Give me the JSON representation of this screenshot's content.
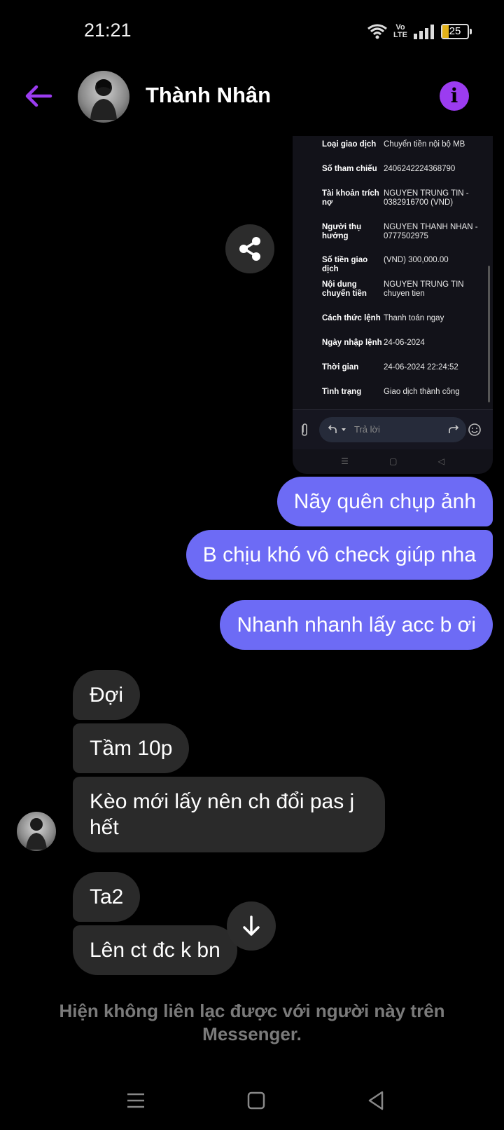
{
  "status_bar": {
    "time": "21:21",
    "network": "VoLTE",
    "battery": "25"
  },
  "header": {
    "contact_name": "Thành Nhân"
  },
  "shared_image": {
    "rows": [
      {
        "label": "Loại giao dịch",
        "value": "Chuyển tiền nội bộ MB"
      },
      {
        "label": "Số tham chiếu",
        "value": "2406242224368790"
      },
      {
        "label": "Tài khoản trích nợ",
        "value": "NGUYEN TRUNG TIN - 0382916700 (VND)"
      },
      {
        "label": "Người thụ hưởng",
        "value": "NGUYEN THANH NHAN - 0777502975"
      },
      {
        "label": "Số tiền giao dịch",
        "value": "(VND) 300,000.00"
      },
      {
        "label": "Nội dung chuyển tiền",
        "value": "NGUYEN TRUNG TIN chuyen tien"
      },
      {
        "label": "Cách thức lệnh",
        "value": "Thanh toán ngay"
      },
      {
        "label": "Ngày nhập lệnh",
        "value": "24-06-2024"
      },
      {
        "label": "Thời gian",
        "value": "24-06-2024 22:24:52"
      },
      {
        "label": "Tình trạng",
        "value": "Giao dịch thành công"
      }
    ],
    "reply_placeholder": "Trả lời"
  },
  "messages": {
    "sent": [
      "Nãy quên chụp ảnh",
      "B chịu khó vô check giúp nha",
      "Nhanh nhanh lấy acc b ơi"
    ],
    "received": [
      "Đợi",
      "Tầm 10p",
      "Kèo mới lấy nên ch đổi pas j hết",
      "Ta2",
      "Lên ct đc k bn"
    ]
  },
  "notice": "Hiện không liên lạc được với người này trên Messenger.",
  "colors": {
    "accent": "#9b3cf0",
    "sent_bubble": "#6d6bf5",
    "received_bubble": "#2a2a2a"
  }
}
